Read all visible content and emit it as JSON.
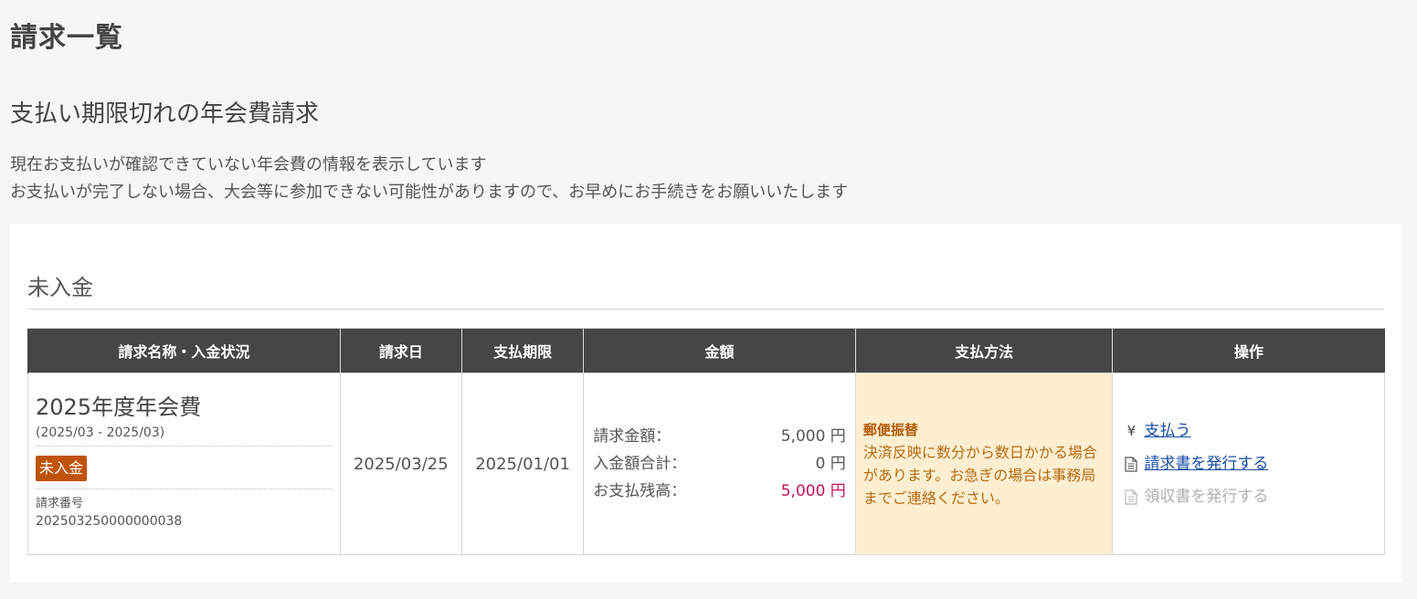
{
  "page": {
    "title": "請求一覧"
  },
  "section": {
    "title": "支払い期限切れの年会費請求",
    "description_line1": "現在お支払いが確認できていない年会費の情報を表示しています",
    "description_line2": "お支払いが完了しない場合、大会等に参加できない可能性がありますので、お早めにお手続きをお願いいたします"
  },
  "card": {
    "heading": "未入金"
  },
  "table": {
    "headers": [
      "請求名称・入金状況",
      "請求日",
      "支払期限",
      "金額",
      "支払方法",
      "操作"
    ],
    "rows": [
      {
        "name": "2025年度年会費",
        "period": "(2025/03 - 2025/03)",
        "status": "未入金",
        "invoice_label": "請求番号",
        "invoice_no": "202503250000000038",
        "billing_date": "2025/03/25",
        "due_date": "2025/01/01",
        "amount": {
          "billed_label": "請求金額：",
          "billed_value": "5,000 円",
          "paid_label": "入金額合計：",
          "paid_value": "0 円",
          "balance_label": "お支払残高：",
          "balance_value": "5,000 円"
        },
        "method": {
          "title": "郵便振替",
          "note": "決済反映に数分から数日かかる場合があります。お急ぎの場合は事務局までご連絡ください。"
        },
        "operations": {
          "pay_icon": "yen-icon",
          "pay": "支払う",
          "invoice_icon": "document-icon",
          "invoice": "請求書を発行する",
          "receipt_icon": "document-icon",
          "receipt": "領収書を発行する"
        }
      }
    ]
  },
  "colors": {
    "background": "#f6f6f6",
    "table_header": "#464646",
    "status_badge": "#c0530b",
    "method_bg": "#fdefd0",
    "balance_text": "#c0155a",
    "link": "#1a4fa8"
  }
}
